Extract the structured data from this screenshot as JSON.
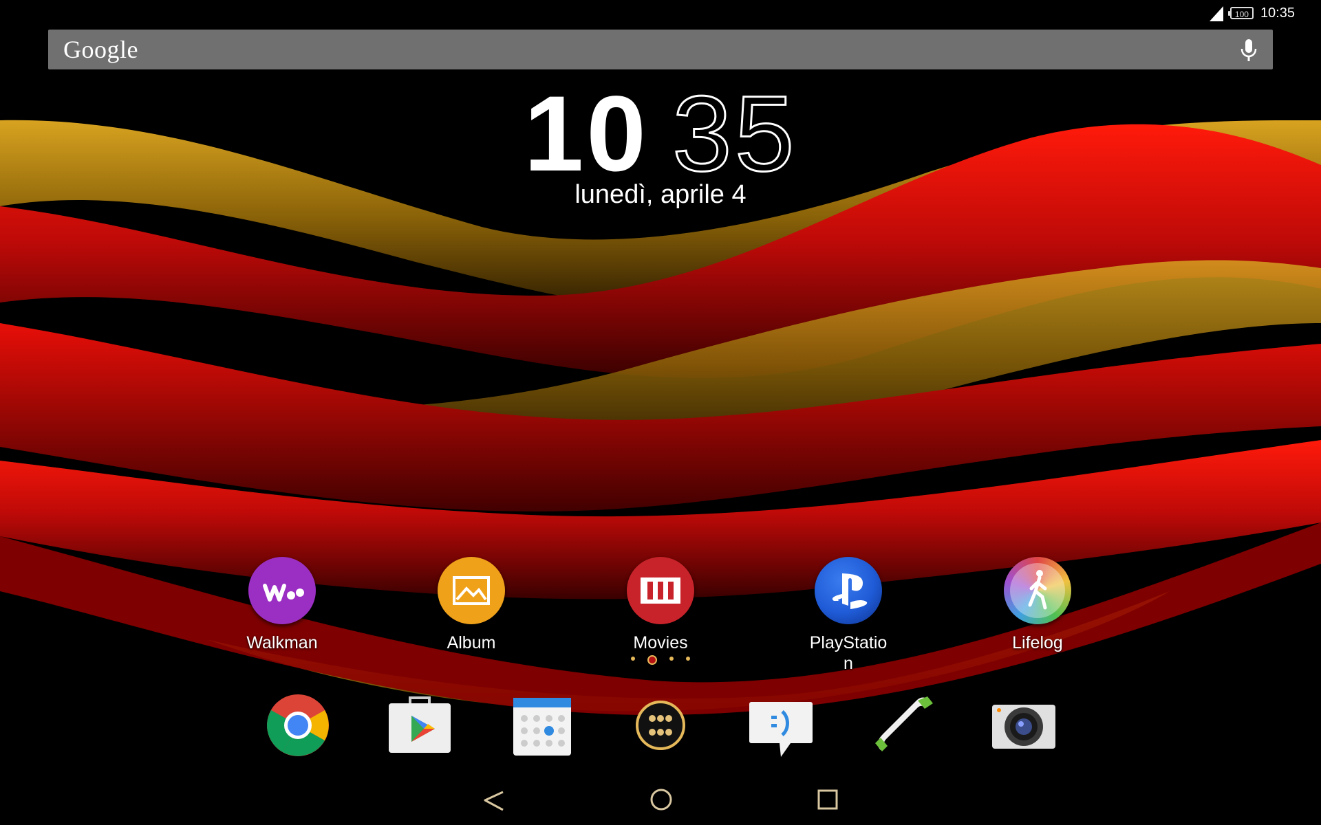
{
  "status_bar": {
    "time": "10:35",
    "battery": "100",
    "icons": [
      "signal-icon",
      "battery-icon"
    ]
  },
  "search": {
    "logo": "Google",
    "icon": "microphone-icon"
  },
  "clock": {
    "hours": "10",
    "minutes": "35",
    "date": "lunedì, aprile 4"
  },
  "apps": [
    {
      "label": "Walkman",
      "icon": "walkman-icon",
      "color": "#9b2fc4"
    },
    {
      "label": "Album",
      "icon": "album-icon",
      "color": "#f0a11a"
    },
    {
      "label": "Movies",
      "icon": "movies-icon",
      "color": "#c8232a"
    },
    {
      "label": "PlayStatio\nn",
      "icon": "playstation-icon",
      "color": "#1f5bd6"
    },
    {
      "label": "Lifelog",
      "icon": "lifelog-icon",
      "color": "#9fb2c4"
    }
  ],
  "pager": {
    "pages": 4,
    "active": 1
  },
  "dock": [
    {
      "name": "chrome-icon"
    },
    {
      "name": "play-store-icon"
    },
    {
      "name": "calendar-icon"
    },
    {
      "name": "app-drawer-icon"
    },
    {
      "name": "messaging-icon"
    },
    {
      "name": "phone-icon"
    },
    {
      "name": "camera-icon"
    }
  ],
  "nav": [
    "back-icon",
    "home-icon",
    "recents-icon"
  ],
  "colors": {
    "wallpaper_red": "#c80a0a",
    "wallpaper_gold": "#b8860b",
    "accent_gold": "#e5b85a"
  }
}
